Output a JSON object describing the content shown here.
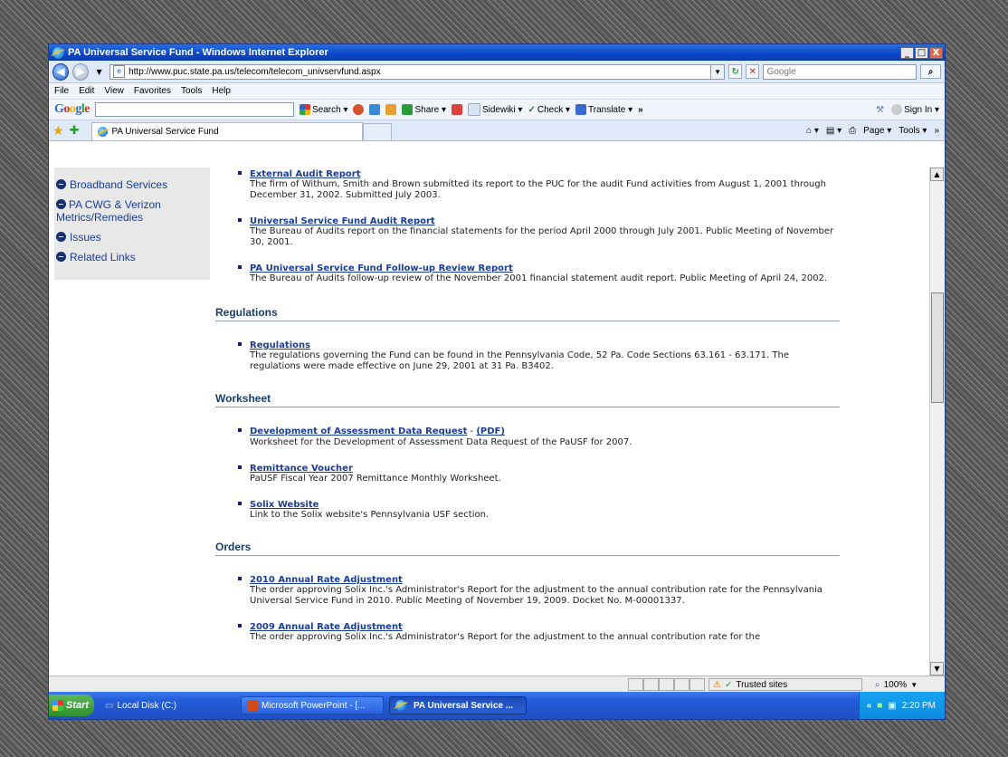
{
  "window": {
    "title": "PA Universal Service Fund - Windows Internet Explorer",
    "buttons": [
      "_",
      "□",
      "X"
    ]
  },
  "address": {
    "url": "http://www.puc.state.pa.us/telecom/telecom_univservfund.aspx",
    "search_placeholder": "Google"
  },
  "menu": [
    "File",
    "Edit",
    "View",
    "Favorites",
    "Tools",
    "Help"
  ],
  "google_toolbar": {
    "logo": "Google",
    "items": [
      "Search ▾",
      "Share ▾",
      "Sidewiki ▾",
      "Check ▾",
      "Translate ▾",
      "»"
    ],
    "sign_in": "Sign In ▾"
  },
  "tabs": {
    "active": "PA Universal Service Fund",
    "tools": [
      "▾",
      "▾",
      "Page ▾",
      "Tools ▾",
      "»"
    ]
  },
  "sidebar": {
    "items": [
      "Broadband Services",
      "PA CWG & Verizon Metrics/Remedies",
      "Issues",
      "Related Links"
    ]
  },
  "content": {
    "top_items": [
      {
        "title": "External Audit Report",
        "desc": "The firm of Withum, Smith and Brown submitted its report to the PUC for the audit Fund activities from August 1, 2001 through December 31, 2002. Submitted July 2003."
      },
      {
        "title": "Universal Service Fund Audit Report",
        "desc": "The Bureau of Audits report on the financial statements for the period April 2000 through July 2001. Public Meeting of November 30, 2001."
      },
      {
        "title": "PA Universal Service Fund Follow-up Review Report",
        "desc": "The Bureau of Audits follow-up review of the November 2001 financial statement audit report.  Public Meeting of April 24, 2002."
      }
    ],
    "regulations": {
      "heading": "Regulations",
      "items": [
        {
          "title": "Regulations",
          "desc": "The regulations governing the Fund can be found in the Pennsylvania Code, 52 Pa. Code Sections 63.161 - 63.171. The regulations were made effective on June 29, 2001 at 31 Pa. B3402."
        }
      ]
    },
    "worksheet": {
      "heading": "Worksheet",
      "items": [
        {
          "title": "Development of Assessment Data Request",
          "extra": "(PDF)",
          "sep": " - ",
          "desc": "Worksheet for the Development of Assessment Data Request of the PaUSF for 2007."
        },
        {
          "title": "Remittance Voucher",
          "desc": "PaUSF Fiscal Year 2007 Remittance Monthly Worksheet."
        },
        {
          "title": "Solix Website",
          "desc": "Link to the Solix website's Pennsylvania USF section."
        }
      ]
    },
    "orders": {
      "heading": "Orders",
      "items": [
        {
          "title": "2010 Annual Rate Adjustment",
          "desc": "The order approving Solix Inc.'s Administrator's Report for the adjustment to the annual contribution rate for the Pennsylvania Universal Service Fund in 2010. Public Meeting of November 19, 2009.  Docket No. M-00001337."
        },
        {
          "title": "2009 Annual Rate Adjustment",
          "desc": "The order approving Solix Inc.'s Administrator's Report for the adjustment to the annual contribution rate for the"
        }
      ]
    }
  },
  "status": {
    "zone": "Trusted sites",
    "zoom": "100%"
  },
  "taskbar": {
    "start": "Start",
    "tasks": [
      "Local Disk (C:)",
      "Microsoft PowerPoint - [...",
      "PA Universal Service ..."
    ],
    "clock": "2:20 PM",
    "tray_chevron": "«"
  },
  "colors": {
    "link": "#1a3d9a",
    "heading": "#1a3d6e",
    "titlebar": "#0b45c8"
  }
}
